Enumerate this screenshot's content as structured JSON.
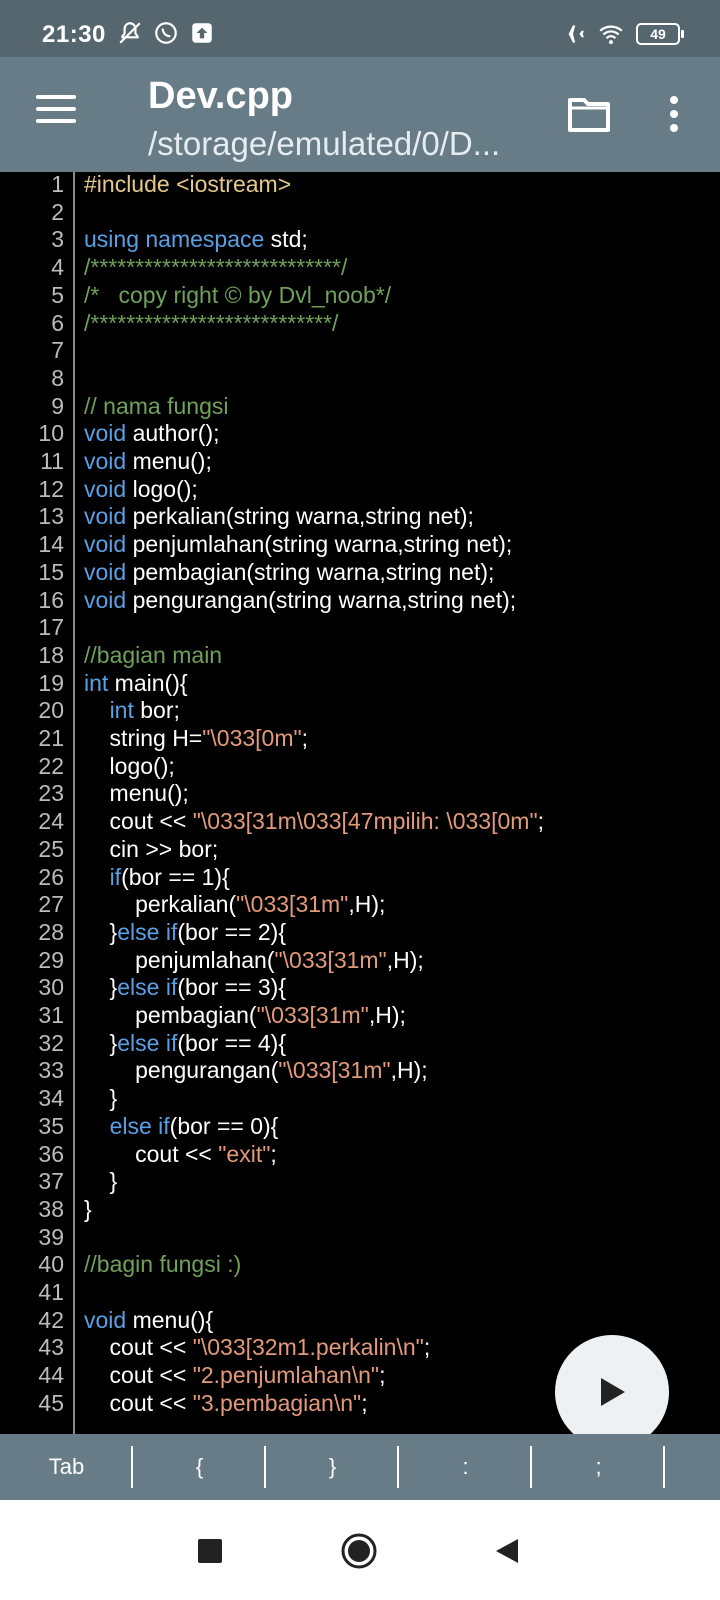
{
  "status_bar": {
    "time": "21:30",
    "battery": "49",
    "icons": [
      "notifications-off-icon",
      "whatsapp-icon",
      "upload-icon",
      "airplane-icon",
      "wifi-icon",
      "battery-icon"
    ]
  },
  "app_bar": {
    "title": "Dev.cpp",
    "subtitle": "/storage/emulated/0/D...",
    "icons": [
      "menu-icon",
      "folder-icon",
      "more-vert-icon"
    ]
  },
  "editor": {
    "lines": [
      {
        "n": "1",
        "segs": [
          {
            "t": "#include <iostream>",
            "c": "pp"
          }
        ]
      },
      {
        "n": "2",
        "segs": []
      },
      {
        "n": "3",
        "segs": [
          {
            "t": "using namespace",
            "c": "kw"
          },
          {
            "t": " std;",
            "c": ""
          }
        ]
      },
      {
        "n": "4",
        "segs": [
          {
            "t": "/****************************/",
            "c": "cm"
          }
        ]
      },
      {
        "n": "5",
        "segs": [
          {
            "t": "/*   copy right © by Dvl_noob*/",
            "c": "cm"
          }
        ]
      },
      {
        "n": "6",
        "segs": [
          {
            "t": "/***************************/",
            "c": "cm"
          }
        ]
      },
      {
        "n": "7",
        "segs": []
      },
      {
        "n": "8",
        "segs": []
      },
      {
        "n": "9",
        "segs": [
          {
            "t": "// nama fungsi",
            "c": "cm"
          }
        ]
      },
      {
        "n": "10",
        "segs": [
          {
            "t": "void",
            "c": "kw"
          },
          {
            "t": " author();",
            "c": ""
          }
        ]
      },
      {
        "n": "11",
        "segs": [
          {
            "t": "void",
            "c": "kw"
          },
          {
            "t": " menu();",
            "c": ""
          }
        ]
      },
      {
        "n": "12",
        "segs": [
          {
            "t": "void",
            "c": "kw"
          },
          {
            "t": " logo();",
            "c": ""
          }
        ]
      },
      {
        "n": "13",
        "segs": [
          {
            "t": "void",
            "c": "kw"
          },
          {
            "t": " perkalian(string warna,string net);",
            "c": ""
          }
        ]
      },
      {
        "n": "14",
        "segs": [
          {
            "t": "void",
            "c": "kw"
          },
          {
            "t": " penjumlahan(string warna,string net);",
            "c": ""
          }
        ]
      },
      {
        "n": "15",
        "segs": [
          {
            "t": "void",
            "c": "kw"
          },
          {
            "t": " pembagian(string warna,string net);",
            "c": ""
          }
        ]
      },
      {
        "n": "16",
        "segs": [
          {
            "t": "void",
            "c": "kw"
          },
          {
            "t": " pengurangan(string warna,string net);",
            "c": ""
          }
        ]
      },
      {
        "n": "17",
        "segs": []
      },
      {
        "n": "18",
        "segs": [
          {
            "t": "//bagian main",
            "c": "cm"
          }
        ]
      },
      {
        "n": "19",
        "segs": [
          {
            "t": "int",
            "c": "kw"
          },
          {
            "t": " main(){",
            "c": ""
          }
        ]
      },
      {
        "n": "20",
        "segs": [
          {
            "t": "    ",
            "c": ""
          },
          {
            "t": "int",
            "c": "kw"
          },
          {
            "t": " bor;",
            "c": ""
          }
        ]
      },
      {
        "n": "21",
        "segs": [
          {
            "t": "    string H=",
            "c": ""
          },
          {
            "t": "\"\\033[0m\"",
            "c": "str"
          },
          {
            "t": ";",
            "c": ""
          }
        ]
      },
      {
        "n": "22",
        "segs": [
          {
            "t": "    logo();",
            "c": ""
          }
        ]
      },
      {
        "n": "23",
        "segs": [
          {
            "t": "    menu();",
            "c": ""
          }
        ]
      },
      {
        "n": "24",
        "segs": [
          {
            "t": "    cout << ",
            "c": ""
          },
          {
            "t": "\"\\033[31m\\033[47mpilih: \\033[0m\"",
            "c": "str"
          },
          {
            "t": ";",
            "c": ""
          }
        ]
      },
      {
        "n": "25",
        "segs": [
          {
            "t": "    cin >> bor;",
            "c": ""
          }
        ]
      },
      {
        "n": "26",
        "segs": [
          {
            "t": "    ",
            "c": ""
          },
          {
            "t": "if",
            "c": "kw"
          },
          {
            "t": "(bor == 1){",
            "c": ""
          }
        ]
      },
      {
        "n": "27",
        "segs": [
          {
            "t": "        perkalian(",
            "c": ""
          },
          {
            "t": "\"\\033[31m\"",
            "c": "str"
          },
          {
            "t": ",H);",
            "c": ""
          }
        ]
      },
      {
        "n": "28",
        "segs": [
          {
            "t": "    }",
            "c": ""
          },
          {
            "t": "else if",
            "c": "kw"
          },
          {
            "t": "(bor == 2){",
            "c": ""
          }
        ]
      },
      {
        "n": "29",
        "segs": [
          {
            "t": "        penjumlahan(",
            "c": ""
          },
          {
            "t": "\"\\033[31m\"",
            "c": "str"
          },
          {
            "t": ",H);",
            "c": ""
          }
        ]
      },
      {
        "n": "30",
        "segs": [
          {
            "t": "    }",
            "c": ""
          },
          {
            "t": "else if",
            "c": "kw"
          },
          {
            "t": "(bor == 3){",
            "c": ""
          }
        ]
      },
      {
        "n": "31",
        "segs": [
          {
            "t": "        pembagian(",
            "c": ""
          },
          {
            "t": "\"\\033[31m\"",
            "c": "str"
          },
          {
            "t": ",H);",
            "c": ""
          }
        ]
      },
      {
        "n": "32",
        "segs": [
          {
            "t": "    }",
            "c": ""
          },
          {
            "t": "else if",
            "c": "kw"
          },
          {
            "t": "(bor == 4){",
            "c": ""
          }
        ]
      },
      {
        "n": "33",
        "segs": [
          {
            "t": "        pengurangan(",
            "c": ""
          },
          {
            "t": "\"\\033[31m\"",
            "c": "str"
          },
          {
            "t": ",H);",
            "c": ""
          }
        ]
      },
      {
        "n": "34",
        "segs": [
          {
            "t": "    }",
            "c": ""
          }
        ]
      },
      {
        "n": "35",
        "segs": [
          {
            "t": "    ",
            "c": ""
          },
          {
            "t": "else if",
            "c": "kw"
          },
          {
            "t": "(bor == 0){",
            "c": ""
          }
        ]
      },
      {
        "n": "36",
        "segs": [
          {
            "t": "        cout << ",
            "c": ""
          },
          {
            "t": "\"exit\"",
            "c": "str"
          },
          {
            "t": ";",
            "c": ""
          }
        ]
      },
      {
        "n": "37",
        "segs": [
          {
            "t": "    }",
            "c": ""
          }
        ]
      },
      {
        "n": "38",
        "segs": [
          {
            "t": "}",
            "c": ""
          }
        ]
      },
      {
        "n": "39",
        "segs": []
      },
      {
        "n": "40",
        "segs": [
          {
            "t": "//bagin fungsi :)",
            "c": "cm"
          }
        ]
      },
      {
        "n": "41",
        "segs": []
      },
      {
        "n": "42",
        "segs": [
          {
            "t": "void",
            "c": "kw"
          },
          {
            "t": " menu(){",
            "c": ""
          }
        ]
      },
      {
        "n": "43",
        "segs": [
          {
            "t": "    cout << ",
            "c": ""
          },
          {
            "t": "\"\\033[32m1.perkalin\\n\"",
            "c": "str"
          },
          {
            "t": ";",
            "c": ""
          }
        ]
      },
      {
        "n": "44",
        "segs": [
          {
            "t": "    cout << ",
            "c": ""
          },
          {
            "t": "\"2.penjumlahan\\n\"",
            "c": "str"
          },
          {
            "t": ";",
            "c": ""
          }
        ]
      },
      {
        "n": "45",
        "segs": [
          {
            "t": "    cout << ",
            "c": ""
          },
          {
            "t": "\"3.pembagian\\n\"",
            "c": "str"
          },
          {
            "t": ";",
            "c": ""
          }
        ]
      }
    ]
  },
  "run_button": {
    "icon": "play-icon"
  },
  "symbol_bar": {
    "keys": [
      "Tab",
      "{",
      "}",
      ":",
      ";"
    ]
  },
  "nav_bar": {
    "icons": [
      "recents-square-icon",
      "home-circle-icon",
      "back-triangle-icon"
    ]
  },
  "colors": {
    "status_bar": "#55666f",
    "app_bar": "#677c87",
    "keyword": "#5aa0e4",
    "string": "#e39a7a",
    "comment": "#6fa15a",
    "preprocessor": "#e6c98a"
  }
}
